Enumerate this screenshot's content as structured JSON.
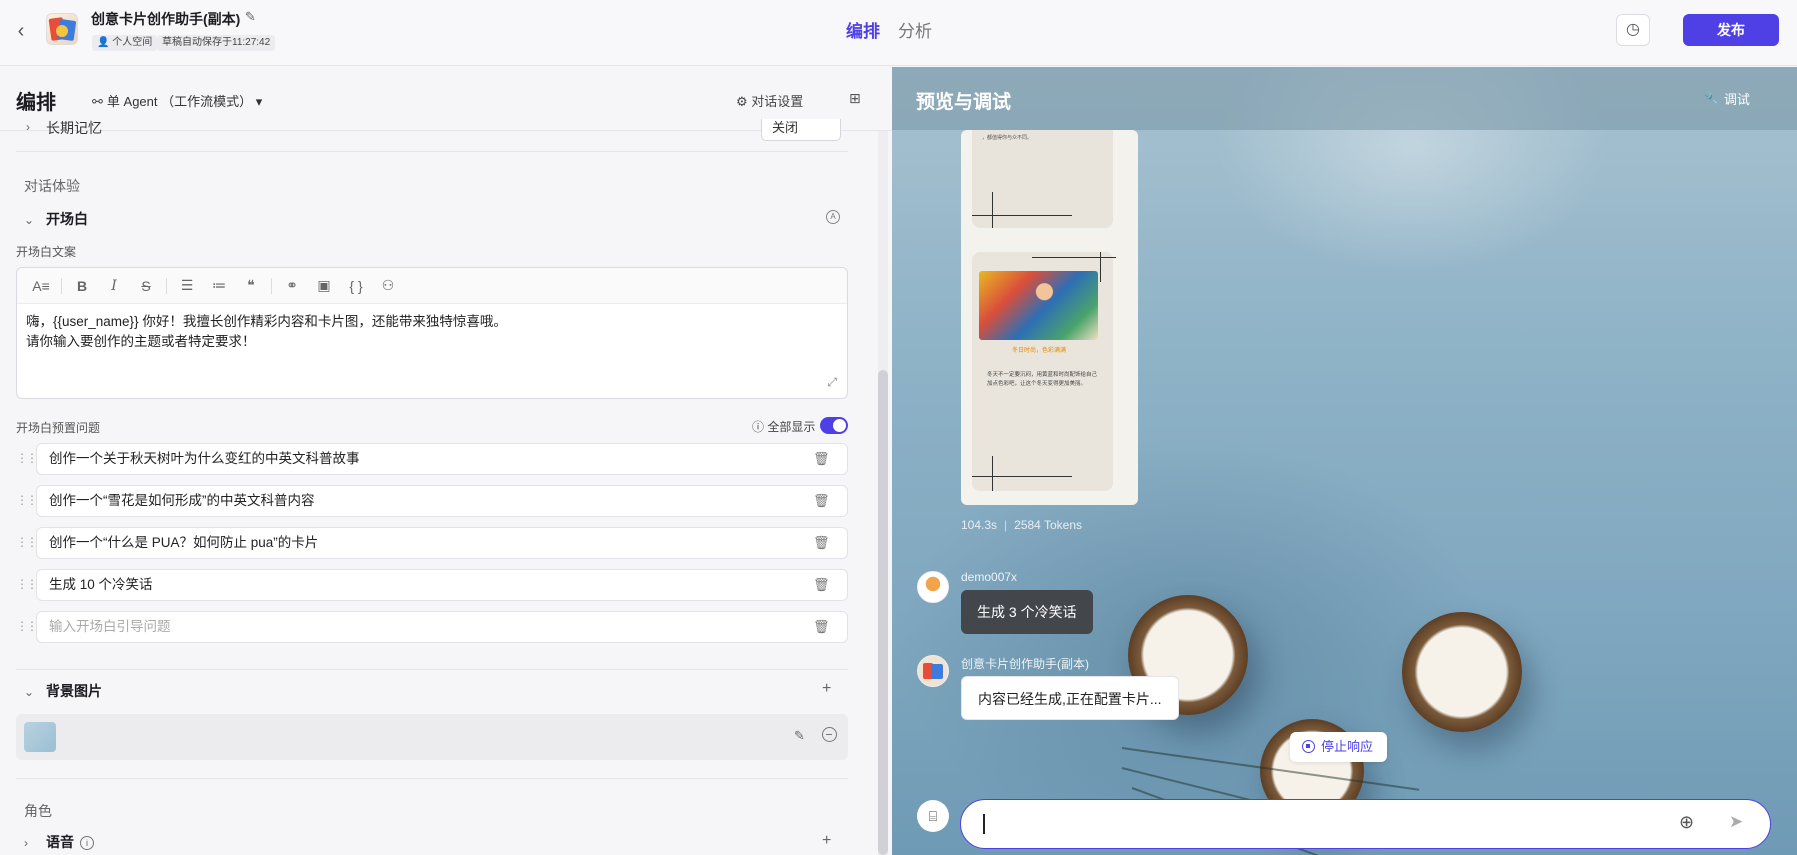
{
  "app": {
    "title": "创意卡片创作助手(副本)",
    "tag_space": "个人空间",
    "tag_autosave": "草稿自动保存于11:27:42"
  },
  "tabs": {
    "arrange": "编排",
    "analysis": "分析"
  },
  "actions": {
    "publish": "发布"
  },
  "left": {
    "title": "编排",
    "agent_mode": "单 Agent （工作流模式）",
    "dialog_settings": "对话设置",
    "long_term_memory": {
      "label": "长期记忆",
      "value": "关闭"
    },
    "section_dialog_experience": "对话体验",
    "opening": {
      "title": "开场白",
      "text_label": "开场白文案",
      "text_line1": "嗨，{{user_name}} 你好！我擅长创作精彩内容和卡片图，还能带来独特惊喜哦。",
      "text_line2": "请你输入要创作的主题或者特定要求！",
      "preset_label": "开场白预置问题",
      "show_all": "全部显示",
      "show_all_enabled": true,
      "questions": [
        "创作一个关于秋天树叶为什么变红的中英文科普故事",
        "创作一个“雪花是如何形成”的中英文科普内容",
        "创作一个“什么是 PUA？如何防止 pua”的卡片",
        "生成 10 个冷笑话"
      ],
      "question_placeholder": "输入开场白引导问题"
    },
    "background": {
      "title": "背景图片"
    },
    "section_role": "角色",
    "voice": {
      "title": "语音"
    }
  },
  "right": {
    "title": "预览与调试",
    "debug": "调试",
    "card_preview": {
      "card1_text": "，都值得你与众不同。",
      "card2_heading": "冬日时尚，色彩满满",
      "card2_body": "冬天不一定要沉闷，用黄蓝和时尚配饰给自己加点色彩吧，让这个冬天变得更加美丽。"
    },
    "stats": {
      "time": "104.3s",
      "tokens": "2584 Tokens"
    },
    "messages": [
      {
        "sender": "demo007x",
        "text": "生成 3 个冷笑话",
        "role": "user"
      },
      {
        "sender": "创意卡片创作助手(副本)",
        "text": "内容已经生成,正在配置卡片...",
        "role": "bot"
      }
    ],
    "stop_response": "停止响应"
  },
  "colors": {
    "accent": "#4e40e5",
    "user_bubble": "#43464b"
  }
}
